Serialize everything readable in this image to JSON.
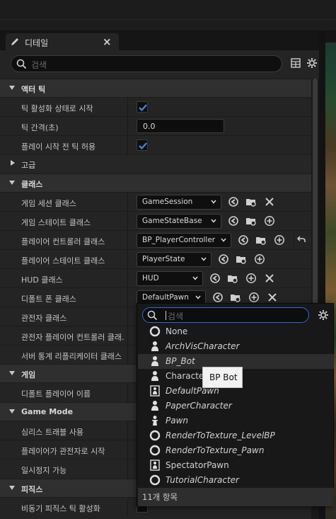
{
  "tab": {
    "title": "디테일",
    "close": "×"
  },
  "search": {
    "placeholder": "검색"
  },
  "sections": {
    "actor_tick": "액터 틱",
    "advanced": "고급",
    "classes": "클래스",
    "game": "게임",
    "game_mode": "Game Mode",
    "physics": "피직스"
  },
  "rows": {
    "start_with_tick": "틱 활성화 상태로 시작",
    "tick_interval": "틱 간격(초)",
    "tick_interval_value": "0.0",
    "allow_tick_before_begin": "플레이 시작 전 틱 허용",
    "game_session_class": "게임 세션 클래스",
    "game_state_class": "게임 스테이트 클래스",
    "player_controller_class": "플레이어 컨트롤러 클래스",
    "player_state_class": "플레이어 스테이트 클래스",
    "hud_class": "HUD 클래스",
    "default_pawn_class": "디폴트 폰 클래스",
    "spectator_class": "관전자 클래스",
    "spectator_pc_class": "관전자 플레이어 컨트롤러 클래…",
    "server_stats_class": "서버 통계 리플리케이터 클래스",
    "default_player_name": "디폴트 플레이어 이름",
    "seamless_travel": "심리스 트래블 사용",
    "start_as_spectator": "플레이어가 관전자로 시작",
    "pausable": "일시정지 가능",
    "async_physics": "비동기 피직스 틱 활성화"
  },
  "combos": {
    "game_session": "GameSession",
    "game_state": "GameStateBase",
    "player_controller": "BP_PlayerController",
    "player_state": "PlayerState",
    "hud": "HUD",
    "default_pawn": "DefaultPawn"
  },
  "popup": {
    "search_placeholder": "검색",
    "items": [
      {
        "label": "None",
        "icon": "circle-icon"
      },
      {
        "label": "ArchVisCharacter",
        "icon": "character-icon"
      },
      {
        "label": "BP_Bot",
        "icon": "character-icon"
      },
      {
        "label": "Characte",
        "icon": "character-icon"
      },
      {
        "label": "DefaultPawn",
        "icon": "pawn-icon"
      },
      {
        "label": "PaperCharacter",
        "icon": "character-icon"
      },
      {
        "label": "Pawn",
        "icon": "pawn-icon"
      },
      {
        "label": "RenderToTexture_LevelBP",
        "icon": "circle-icon"
      },
      {
        "label": "RenderToTexture_Pawn",
        "icon": "circle-icon"
      },
      {
        "label": "SpectatorPawn",
        "icon": "pawn-icon"
      },
      {
        "label": "TutorialCharacter",
        "icon": "circle-icon"
      }
    ],
    "footer": "11개 항목"
  },
  "tooltip": "BP Bot",
  "colors": {
    "accent": "#2a6bd8",
    "check": "#3a8ee6"
  }
}
